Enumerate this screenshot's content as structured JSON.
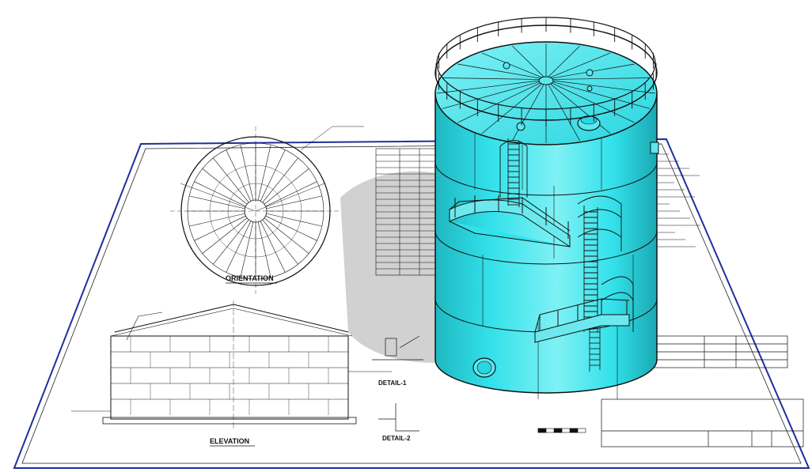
{
  "drawing": {
    "plan_title": "ORIENTATION",
    "elevation_title": "ELEVATION",
    "detail_1_title": "DETAIL-1",
    "detail_2_title": "DETAIL-2"
  },
  "colors": {
    "tank_body": "#33e1ea",
    "tank_shade": "#1fb8c2",
    "tank_light": "#7ff1f5",
    "sheet_border": "#1f2f9c",
    "shadow": "#c9c9c9",
    "line": "#111111"
  },
  "icons": [
    "tank-3d-model",
    "blueprint-sheet"
  ]
}
